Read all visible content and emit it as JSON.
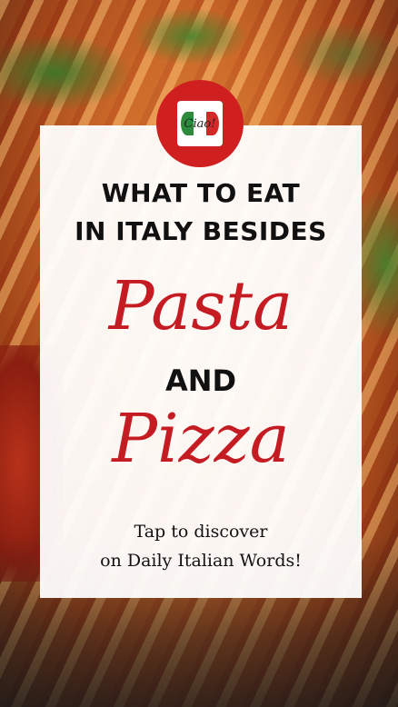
{
  "logo": {
    "text": "Ciao!",
    "icon": "ciao-speech-bubble-logo"
  },
  "headline": {
    "line1": "WHAT TO EAT",
    "line2": "IN ITALY BESIDES",
    "word1": "Pasta",
    "connector": "AND",
    "word2": "Pizza"
  },
  "cta": {
    "line1": "Tap to discover",
    "line2": "on Daily Italian Words!"
  },
  "colors": {
    "accent": "#c41c22",
    "logo_circle": "#cf1f1f",
    "card": "#ffffff",
    "text": "#111111"
  }
}
